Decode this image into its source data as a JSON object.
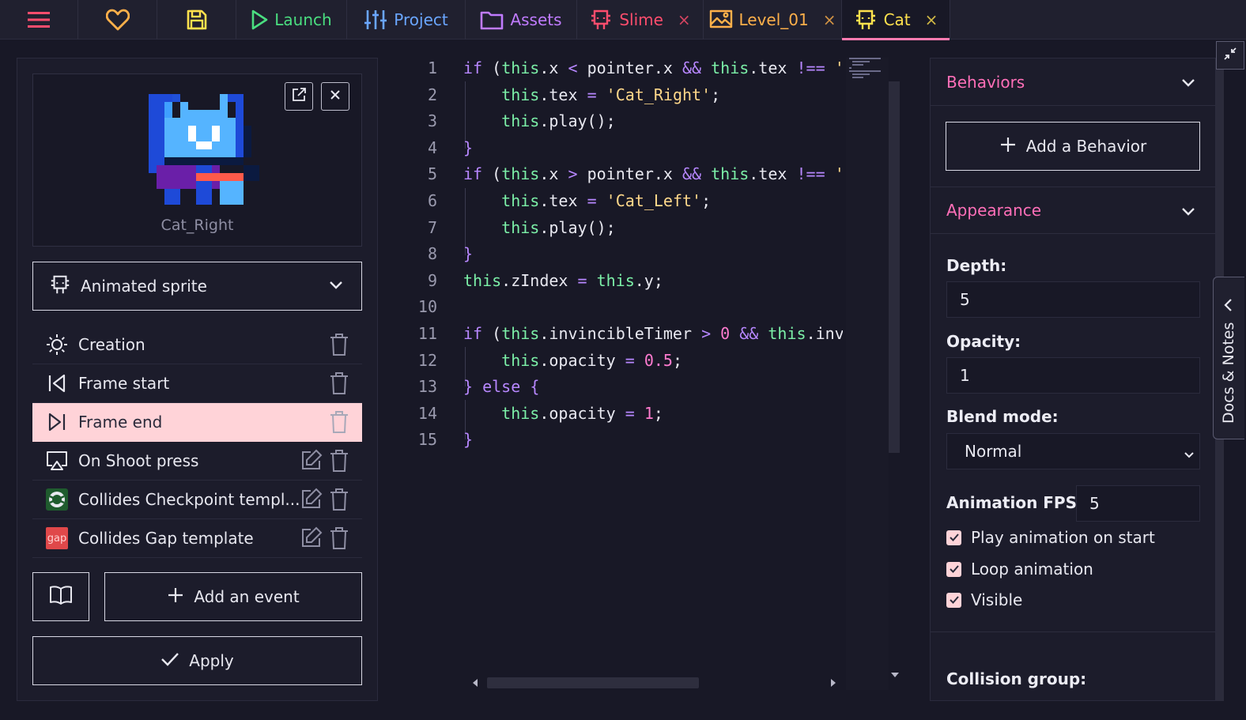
{
  "colors": {
    "accent_pink": "#ff6fb8",
    "launch_green": "#4ade80",
    "project_blue": "#6aa6ff",
    "assets_purple": "#c07bff",
    "slime_red": "#ff4d6d",
    "level_orange": "#ffb04a",
    "cat_yellow": "#ffe14d",
    "active_row_bg": "#ffd3d8"
  },
  "tabs": [
    {
      "label": "",
      "icon": "menu-icon"
    },
    {
      "label": "",
      "icon": "heart-icon"
    },
    {
      "label": "",
      "icon": "save-icon"
    },
    {
      "label": "Launch",
      "icon": "play-icon"
    },
    {
      "label": "Project",
      "icon": "sliders-icon"
    },
    {
      "label": "Assets",
      "icon": "folder-icon"
    },
    {
      "label": "Slime",
      "icon": "template-icon",
      "closable": true
    },
    {
      "label": "Level_01",
      "icon": "room-icon",
      "closable": true
    },
    {
      "label": "Cat",
      "icon": "template-icon",
      "closable": true,
      "active": true
    }
  ],
  "close_glyph": "×",
  "left_panel": {
    "sprite_name": "Cat_Right",
    "base_class": "Animated sprite",
    "events": [
      {
        "label": "Creation",
        "icon": "sun-icon"
      },
      {
        "label": "Frame start",
        "icon": "skip-back-icon"
      },
      {
        "label": "Frame end",
        "icon": "skip-forward-icon",
        "active": true
      },
      {
        "label": "On Shoot press",
        "icon": "cast-icon"
      },
      {
        "label": "Collides Checkpoint templ...",
        "icon": "checkpoint-thumb-icon"
      },
      {
        "label": "Collides Gap template",
        "icon": "gap-thumb-icon",
        "thumb_text": "gap"
      }
    ],
    "add_event_label": "Add an event",
    "apply_label": "Apply"
  },
  "editor": {
    "line_numbers": [
      "1",
      "2",
      "3",
      "4",
      "5",
      "6",
      "7",
      "8",
      "9",
      "10",
      "11",
      "12",
      "13",
      "14",
      "15"
    ]
  },
  "right_panel": {
    "behaviors_title": "Behaviors",
    "add_behavior_label": "Add a Behavior",
    "appearance_title": "Appearance",
    "depth_label": "Depth:",
    "depth_value": "5",
    "opacity_label": "Opacity:",
    "opacity_value": "1",
    "blend_label": "Blend mode:",
    "blend_value": "Normal",
    "fps_label": "Animation FPS:",
    "fps_value": "5",
    "checkboxes": [
      {
        "label": "Play animation on start",
        "checked": true
      },
      {
        "label": "Loop animation",
        "checked": true
      },
      {
        "label": "Visible",
        "checked": true
      }
    ],
    "collision_label": "Collision group:"
  },
  "docs_tab_label": "Docs & Notes"
}
